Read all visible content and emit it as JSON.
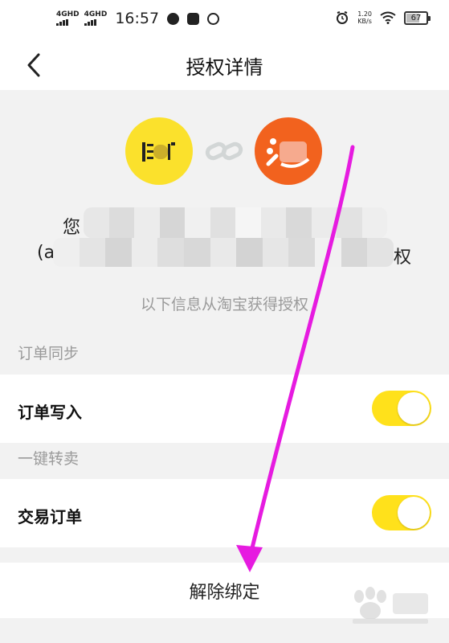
{
  "status_bar": {
    "net1": "4GHD",
    "net2": "4GHD",
    "time": "16:57",
    "speed_value": "1.20",
    "speed_unit": "KB/s",
    "battery": "67",
    "battery_level": 0.67
  },
  "nav": {
    "title": "授权详情"
  },
  "auth": {
    "line1_prefix": "您",
    "line2_prefix": "(a",
    "line2_suffix": "权",
    "hint": "以下信息从淘宝获得授权"
  },
  "sections": {
    "order_sync_label": "订单同步",
    "order_write_label": "订单写入",
    "order_write_on": true,
    "quick_resale_label": "一键转卖",
    "trade_order_label": "交易订单",
    "trade_order_on": true
  },
  "actions": {
    "unbind_label": "解除绑定"
  },
  "colors": {
    "accent_yellow": "#ffe11b",
    "taobao_orange": "#f2621e",
    "arrow_magenta": "#e61be0"
  }
}
